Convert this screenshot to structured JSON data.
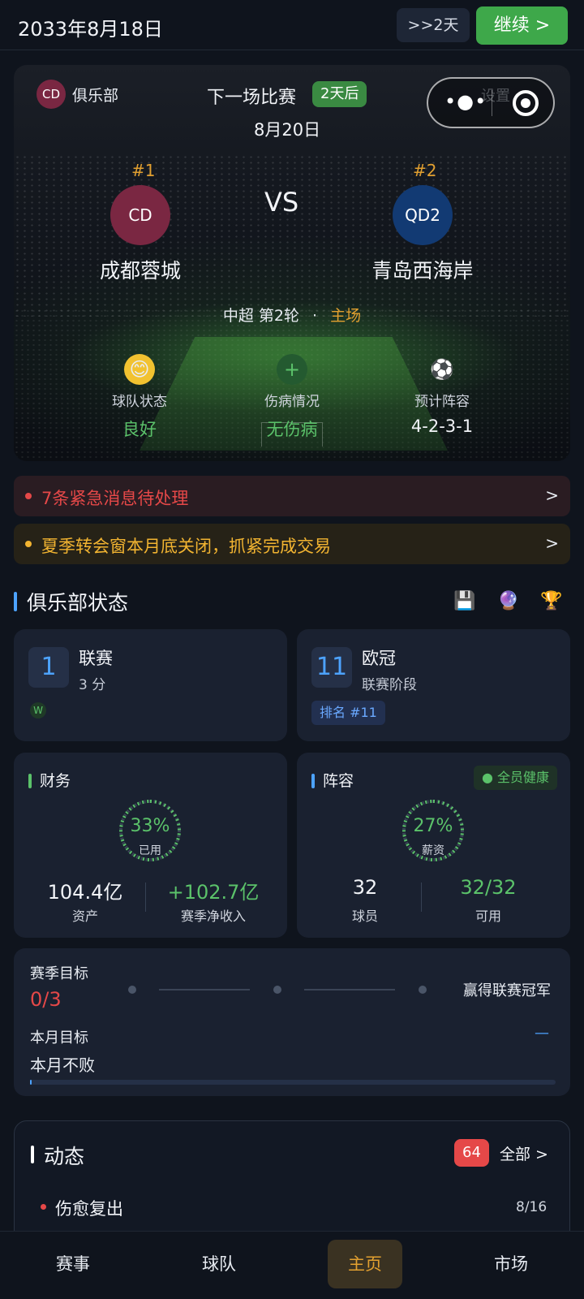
{
  "topbar": {
    "date": "2033年8月18日",
    "skip_label": ">>2天",
    "continue_label": "继续 >"
  },
  "hero": {
    "club_badge": "CD",
    "club_label": "俱乐部",
    "next_match_title": "下一场比赛",
    "days_until": "2天后",
    "match_date": "8月20日",
    "settings_label": "设置",
    "home": {
      "rank": "#1",
      "badge": "CD",
      "name": "成都蓉城",
      "color": "#7a2742"
    },
    "away": {
      "rank": "#2",
      "badge": "QD2",
      "name": "青岛西海岸",
      "color": "#123a73"
    },
    "vs": "VS",
    "competition": "中超 第2轮",
    "separator": "·",
    "venue": "主场",
    "stats": [
      {
        "icon": "smile-face-icon",
        "name": "球队状态",
        "value": "良好"
      },
      {
        "icon": "plus-medical-icon",
        "name": "伤病情况",
        "value": "无伤病"
      },
      {
        "icon": "soccer-ball-icon",
        "name": "预计阵容",
        "value": "4-2-3-1"
      }
    ]
  },
  "alerts": [
    {
      "text": "7条紧急消息待处理",
      "chevron": ">",
      "color": "#e54848"
    },
    {
      "text": "夏季转会窗本月底关闭，抓紧完成交易",
      "chevron": ">",
      "color": "#f2b431"
    }
  ],
  "club_status": {
    "title": "俱乐部状态",
    "icons": [
      "save-disk-icon",
      "crystal-ball-icon",
      "trophy-icon"
    ],
    "league": {
      "position": "1",
      "name": "联赛",
      "points": "3 分",
      "form": [
        "W"
      ]
    },
    "europe": {
      "position": "11",
      "name": "欧冠",
      "stage": "联赛阶段",
      "rank_label": "排名 #11"
    },
    "finance": {
      "title": "财务",
      "gauge_value": "33%",
      "gauge_label": "已用",
      "gauge_fraction": 0.33,
      "assets": "104.4亿",
      "assets_label": "资产",
      "net_income": "+102.7亿",
      "net_income_label": "赛季净收入"
    },
    "squad": {
      "title": "阵容",
      "health": "全员健康",
      "gauge_value": "27%",
      "gauge_label": "薪资",
      "gauge_fraction": 0.27,
      "players": "32",
      "players_label": "球员",
      "available": "32/32",
      "available_label": "可用"
    }
  },
  "goals": {
    "season_label": "赛季目标",
    "season_progress": "0/3",
    "season_target": "赢得联赛冠军",
    "month_label": "本月目标",
    "month_goal": "本月不败",
    "month_status": "—",
    "month_progress": 0.0
  },
  "activity": {
    "title": "动态",
    "count": "64",
    "all_label": "全部 >",
    "items": [
      {
        "text": "伤愈复出",
        "date": "8/16"
      }
    ]
  },
  "nav": {
    "items": [
      "赛事",
      "球队",
      "主页",
      "市场"
    ],
    "active": "主页"
  },
  "colors": {
    "accent_green": "#3ea84a",
    "accent_orange": "#e2a030",
    "accent_blue": "#4da3ff",
    "alert_red": "#e54848"
  }
}
